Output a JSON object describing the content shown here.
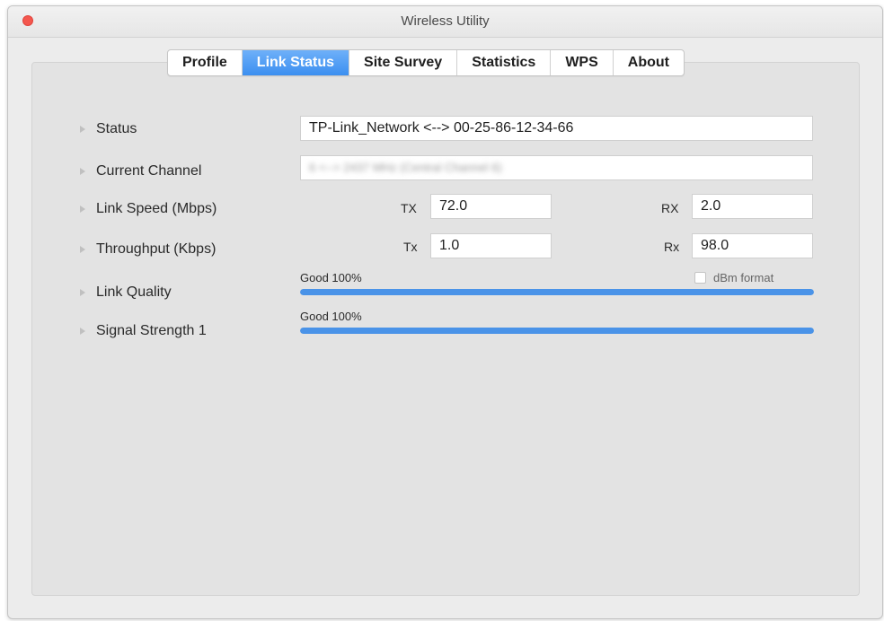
{
  "window": {
    "title": "Wireless Utility"
  },
  "tabs": [
    {
      "label": "Profile",
      "active": false
    },
    {
      "label": "Link Status",
      "active": true
    },
    {
      "label": "Site Survey",
      "active": false
    },
    {
      "label": "Statistics",
      "active": false
    },
    {
      "label": "WPS",
      "active": false
    },
    {
      "label": "About",
      "active": false
    }
  ],
  "rows": {
    "status": {
      "label": "Status",
      "value": "TP-Link_Network <--> 00-25-86-12-34-66"
    },
    "current_channel": {
      "label": "Current Channel",
      "value": "6 <--> 2437 MHz (Central Channel 6)"
    },
    "link_speed": {
      "label": "Link Speed (Mbps)",
      "tx_label": "TX",
      "tx_value": "72.0",
      "rx_label": "RX",
      "rx_value": "2.0"
    },
    "throughput": {
      "label": "Throughput (Kbps)",
      "tx_label": "Tx",
      "tx_value": "1.0",
      "rx_label": "Rx",
      "rx_value": "98.0"
    },
    "link_quality": {
      "label": "Link Quality",
      "text": "Good 100%",
      "percent": 100,
      "dbm_label": "dBm format",
      "dbm_checked": false
    },
    "signal_strength": {
      "label": "Signal Strength 1",
      "text": "Good 100%",
      "percent": 100
    }
  },
  "colors": {
    "accent": "#4a93e8",
    "tab_active": "#3c8ff0",
    "close_button": "#f4574e"
  },
  "icons": {
    "close": "close-button-icon",
    "row_bullet": "disclosure-triangle-icon"
  }
}
